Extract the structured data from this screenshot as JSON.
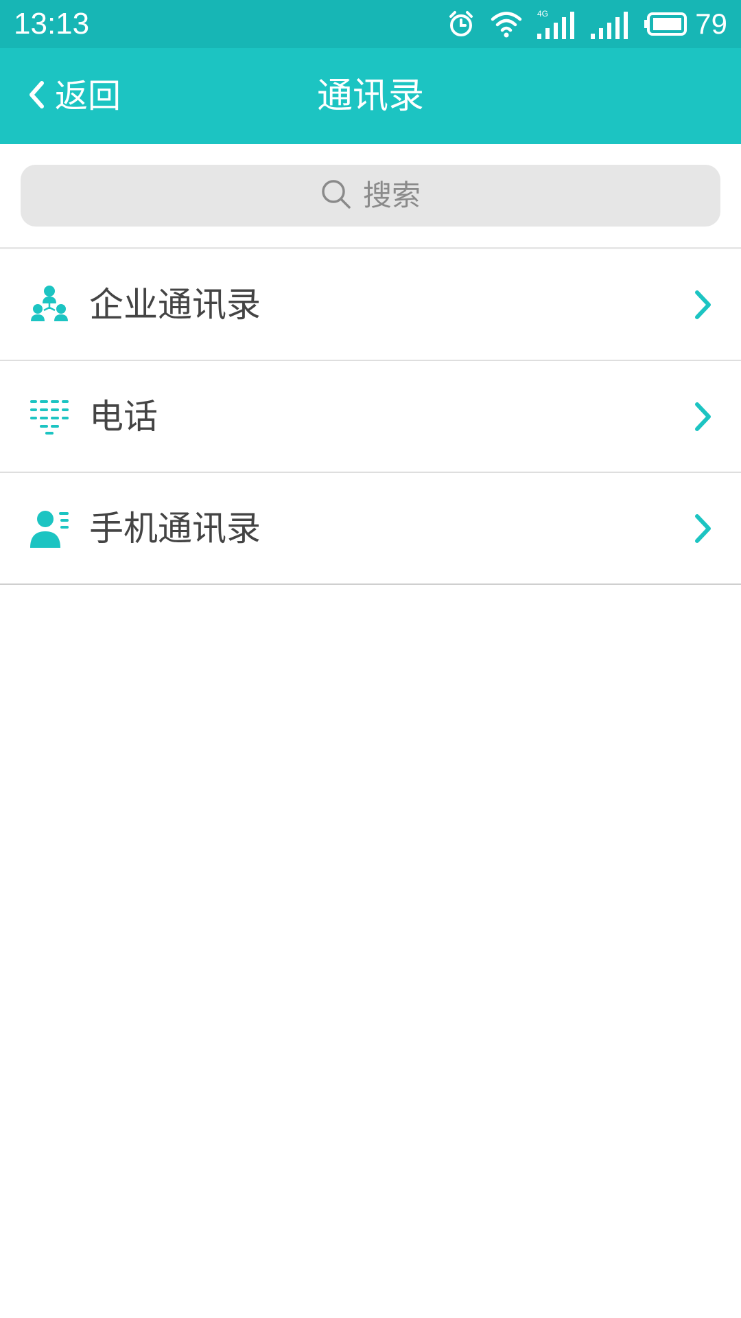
{
  "status_bar": {
    "time": "13:13",
    "battery_level": "79",
    "icons": [
      "alarm-icon",
      "wifi-icon",
      "signal-4g-icon",
      "signal-icon",
      "battery-icon"
    ],
    "network_label": "4G"
  },
  "nav": {
    "back_label": "返回",
    "title": "通讯录"
  },
  "search": {
    "placeholder": "搜索"
  },
  "list": {
    "items": [
      {
        "label": "企业通讯录",
        "icon": "organization-icon"
      },
      {
        "label": "电话",
        "icon": "phone-list-icon"
      },
      {
        "label": "手机通讯录",
        "icon": "contact-card-icon"
      }
    ]
  },
  "colors": {
    "status_bar": "#17b6b5",
    "nav_bar": "#1cc4c2",
    "accent": "#1cc4c2",
    "search_bg": "#e6e6e6",
    "text": "#444444"
  }
}
